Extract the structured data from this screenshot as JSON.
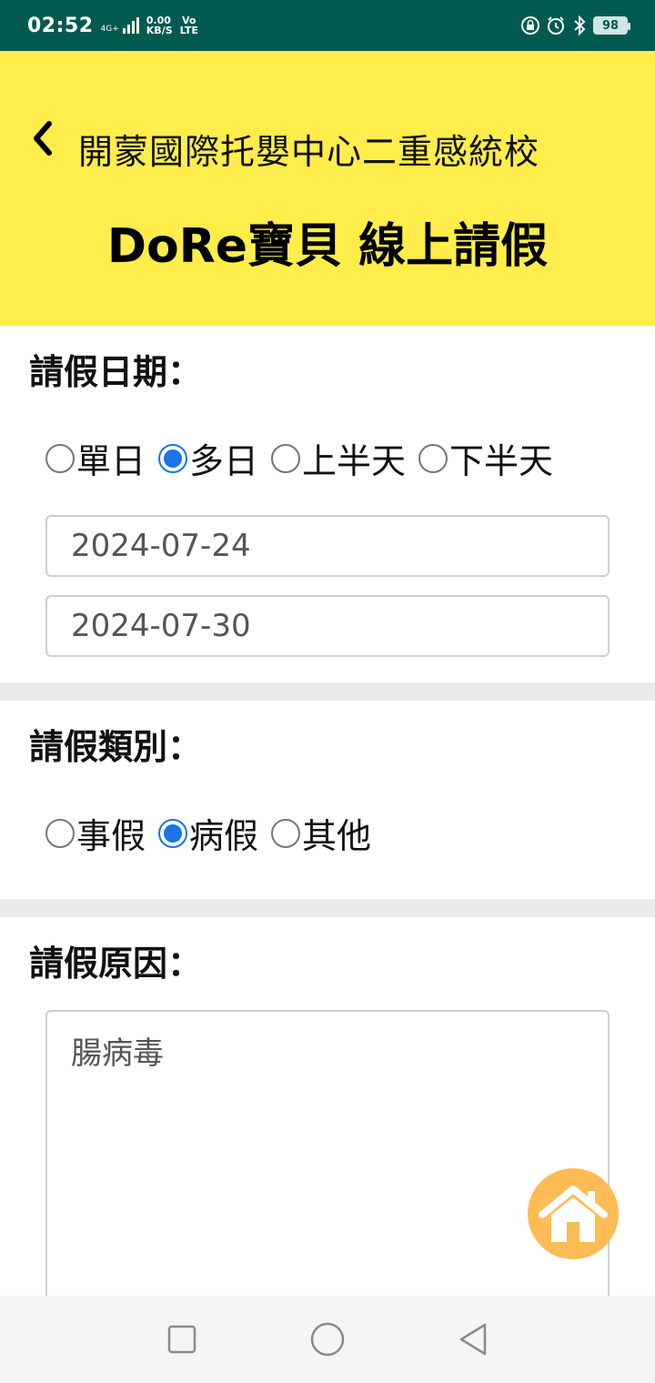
{
  "status_bar": {
    "time": "02:52",
    "network": "4G+",
    "speed_value": "0.00",
    "speed_unit": "KB/S",
    "volte_top": "Vo",
    "volte_bottom": "LTE",
    "battery": "98"
  },
  "header": {
    "school_name": "開蒙國際托嬰中心二重感統校",
    "title": "DoRe寶貝 線上請假",
    "background_color": "#ffed4b"
  },
  "leave_date": {
    "label": "請假日期：",
    "options": [
      {
        "label": "單日",
        "checked": false
      },
      {
        "label": "多日",
        "checked": true
      },
      {
        "label": "上半天",
        "checked": false
      },
      {
        "label": "下半天",
        "checked": false
      }
    ],
    "start_date": "2024-07-24",
    "end_date": "2024-07-30"
  },
  "leave_type": {
    "label": "請假類別：",
    "options": [
      {
        "label": "事假",
        "checked": false
      },
      {
        "label": "病假",
        "checked": true
      },
      {
        "label": "其他",
        "checked": false
      }
    ]
  },
  "leave_reason": {
    "label": "請假原因：",
    "value": "腸病毒"
  },
  "icons": {
    "back": "chevron-left-icon",
    "home": "home-icon",
    "nav_recent": "square-icon",
    "nav_home": "circle-icon",
    "nav_back": "triangle-back-icon"
  },
  "colors": {
    "status_bar": "#005a4f",
    "radio_checked": "#1a73e8",
    "home_fab": "#ffbb55"
  }
}
